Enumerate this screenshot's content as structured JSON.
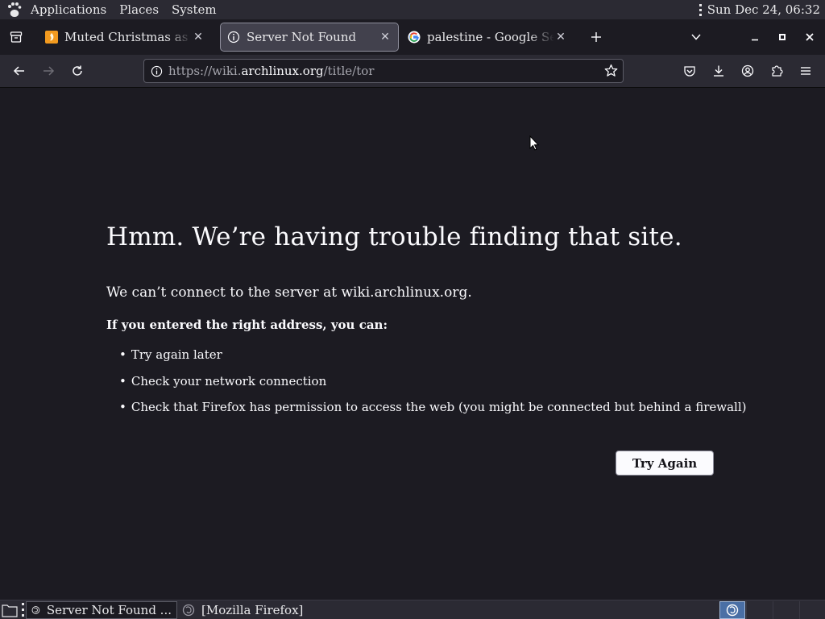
{
  "top_panel": {
    "menus": [
      "Applications",
      "Places",
      "System"
    ],
    "clock": "Sun Dec 24, 06:32"
  },
  "tabs": [
    {
      "title": "Muted Christmas as Palestine",
      "icon": "aljazeera-favicon",
      "active": false
    },
    {
      "title": "Server Not Found",
      "icon": "info-icon",
      "active": true
    },
    {
      "title": "palestine - Google Search",
      "icon": "google-favicon",
      "active": false
    }
  ],
  "address_bar": {
    "url_prefix": "https://wiki.",
    "url_domain": "archlinux.org",
    "url_path": "/title/tor"
  },
  "error": {
    "title": "Hmm. We’re having trouble finding that site.",
    "description": "We can’t connect to the server at wiki.archlinux.org.",
    "hint": "If you entered the right address, you can:",
    "suggestions": [
      "Try again later",
      "Check your network connection",
      "Check that Firefox has permission to access the web (you might be connected but behind a firewall)"
    ],
    "button_label": "Try Again"
  },
  "taskbar": {
    "tasks": [
      {
        "label": "Server Not Found ...",
        "active": true
      },
      {
        "label": "[Mozilla Firefox]",
        "active": false
      }
    ]
  },
  "colors": {
    "page_bg": "#1c1b22",
    "toolbar_bg": "#2b2a33",
    "text": "#fbfbfe",
    "workspace_active": "#4a6fa5"
  }
}
